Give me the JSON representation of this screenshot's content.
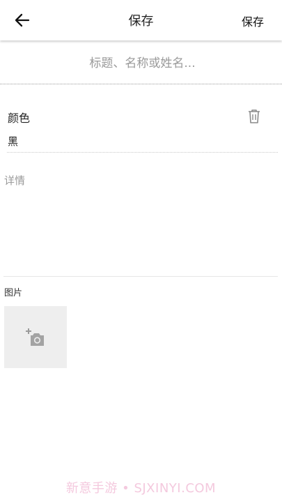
{
  "header": {
    "title": "保存",
    "save_label": "保存"
  },
  "title_field": {
    "placeholder": "标题、名称或姓名...",
    "value": ""
  },
  "custom_field": {
    "label": "颜色",
    "value": "黑"
  },
  "details": {
    "placeholder": "详情",
    "value": ""
  },
  "images": {
    "label": "图片"
  },
  "watermark": "新意手游 • SJXINYI.COM",
  "icons": {
    "back": "arrow-left-icon",
    "delete": "trash-icon",
    "add_photo": "add-photo-camera-icon"
  },
  "colors": {
    "accent": "#222222",
    "placeholder": "#9a9a9a",
    "tile": "#eeeeee",
    "watermark": "#f4c9de"
  }
}
